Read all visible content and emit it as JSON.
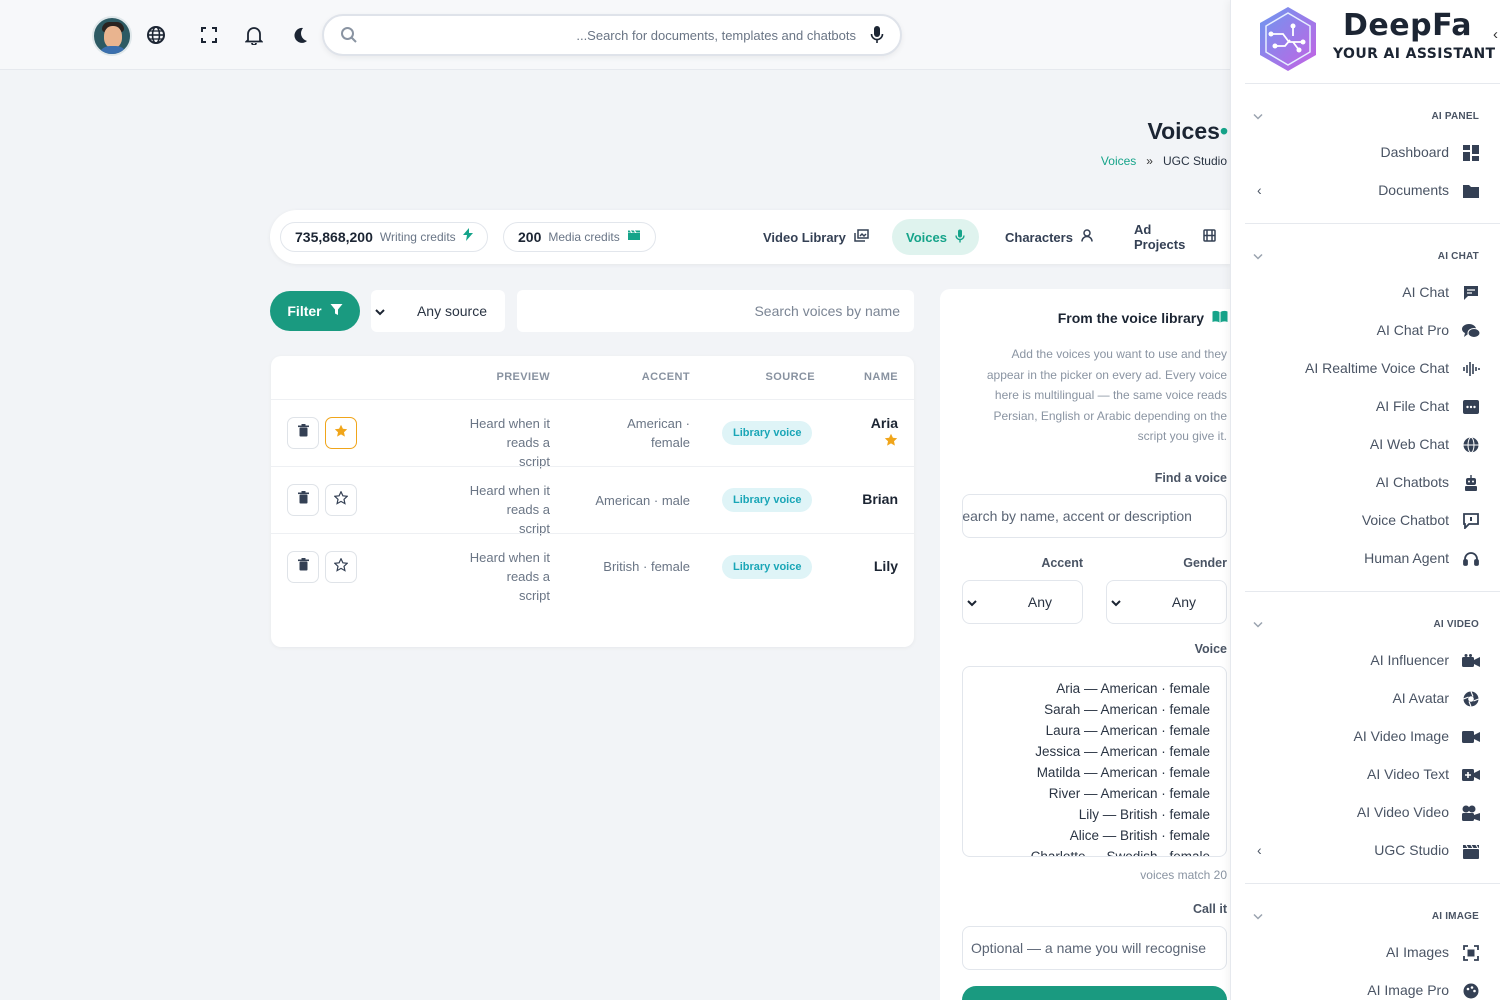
{
  "topbar": {
    "search_placeholder": "...Search for documents, templates and chatbots"
  },
  "page": {
    "title": "Voices",
    "breadcrumb": {
      "link": "Voices",
      "separator": "»",
      "current": "UGC Studio"
    }
  },
  "credits": {
    "writing_value": "735,868,200",
    "writing_label": "Writing credits",
    "media_value": "200",
    "media_label": "Media credits"
  },
  "tabs": [
    {
      "label": "Video Library",
      "icon": "photo-library-icon"
    },
    {
      "label": "Voices",
      "icon": "microphone-icon",
      "active": true
    },
    {
      "label": "Characters",
      "icon": "person-icon"
    },
    {
      "label": "Ad Projects",
      "icon": "film-icon"
    }
  ],
  "filter": {
    "button_label": "Filter",
    "source_value": "Any source",
    "search_placeholder": "Search voices by name"
  },
  "table": {
    "headers": {
      "preview": "PREVIEW",
      "accent": "ACCENT",
      "source": "SOURCE",
      "name": "NAME"
    },
    "rows": [
      {
        "preview_l1": "Heard when it reads a",
        "preview_l2": "script",
        "accent_l1": "American ·",
        "accent_l2": "female",
        "source": "Library voice",
        "name": "Aria",
        "favorite": true
      },
      {
        "preview_l1": "Heard when it reads a",
        "preview_l2": "script",
        "accent_l1": "American · male",
        "accent_l2": "",
        "source": "Library voice",
        "name": "Brian",
        "favorite": false
      },
      {
        "preview_l1": "Heard when it reads a",
        "preview_l2": "script",
        "accent_l1": "British · female",
        "accent_l2": "",
        "source": "Library voice",
        "name": "Lily",
        "favorite": false
      }
    ]
  },
  "library": {
    "title": "From the voice library",
    "desc_1": "Add the voices you want to use and they",
    "desc_2": "appear in the picker on every ad. Every voice",
    "desc_3": "here is multilingual — the same voice reads",
    "desc_4": "Persian, English or Arabic depending on the",
    "desc_5": "script you give it.",
    "find_label": "Find a voice",
    "find_placeholder": "Search by name, accent or description",
    "accent_label": "Accent",
    "accent_value": "Any",
    "gender_label": "Gender",
    "gender_value": "Any",
    "voice_label": "Voice",
    "voices": [
      "Aria — American · female",
      "Sarah — American · female",
      "Laura — American · female",
      "Jessica — American · female",
      "Matilda — American · female",
      "River — American · female",
      "Lily — British · female",
      "Alice — British · female",
      "Charlotte — Swedish · female"
    ],
    "match_text": "voices match 20",
    "call_label": "Call it",
    "call_placeholder": "Optional — a name you will recognise"
  },
  "sidebar": {
    "brand_name": "DeepFa",
    "brand_tagline": "YOUR AI ASSISTANT",
    "sections": {
      "panel": "AI PANEL",
      "chat": "AI CHAT",
      "video": "AI VIDEO",
      "image": "AI IMAGE"
    },
    "items": {
      "dashboard": "Dashboard",
      "documents": "Documents",
      "ai_chat": "AI Chat",
      "ai_chat_pro": "AI Chat Pro",
      "ai_realtime": "AI Realtime Voice Chat",
      "ai_file_chat": "AI File Chat",
      "ai_web_chat": "AI Web Chat",
      "ai_chatbots": "AI Chatbots",
      "voice_chatbot": "Voice Chatbot",
      "human_agent": "Human Agent",
      "ai_influencer": "AI Influencer",
      "ai_avatar": "AI Avatar",
      "ai_video_image": "AI Video Image",
      "ai_video_text": "AI Video Text",
      "ai_video_video": "AI Video Video",
      "ugc_studio": "UGC Studio",
      "ai_images": "AI Images",
      "ai_image_pro": "AI Image Pro"
    }
  },
  "colors": {
    "accent": "#1a9a80",
    "badge_bg": "#dff4f7",
    "badge_text": "#1aa6b7",
    "star": "#f0a51a"
  }
}
